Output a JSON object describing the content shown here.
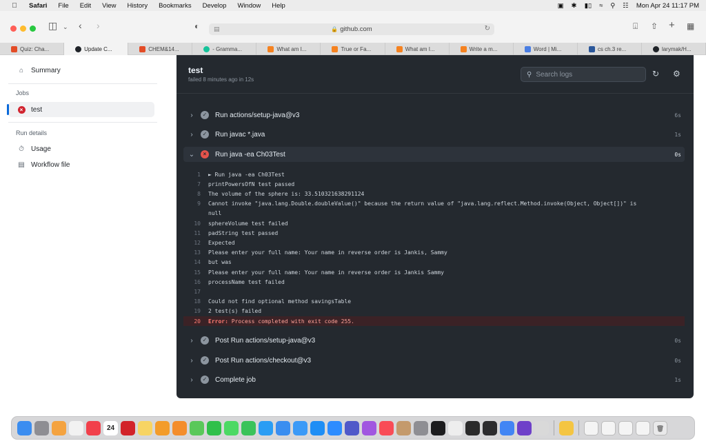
{
  "menubar": {
    "apple_icon": "apple-logo-icon",
    "items": [
      "Safari",
      "File",
      "Edit",
      "View",
      "History",
      "Bookmarks",
      "Develop",
      "Window",
      "Help"
    ],
    "datetime": "Mon Apr 24  11:17 PM"
  },
  "browser": {
    "url": "github.com",
    "tabs": [
      {
        "label": "Quiz: Cha...",
        "favicon_color": "#e34c26"
      },
      {
        "label": "Update C...",
        "favicon_color": "#1f2328"
      },
      {
        "label": "CHEM&14...",
        "favicon_color": "#e34c26"
      },
      {
        "label": "- Gramma...",
        "favicon_color": "#15c39a"
      },
      {
        "label": "What am I...",
        "favicon_color": "#f58220"
      },
      {
        "label": "True or Fa...",
        "favicon_color": "#f58220"
      },
      {
        "label": "What am I...",
        "favicon_color": "#f58220"
      },
      {
        "label": "Write a m...",
        "favicon_color": "#f58220"
      },
      {
        "label": "Word | Mi...",
        "favicon_color": "#4a7ee3"
      },
      {
        "label": "cs ch.3 re...",
        "favicon_color": "#2b579a"
      },
      {
        "label": "larymak/H...",
        "favicon_color": "#1f2328"
      }
    ],
    "active_tab": 1
  },
  "sidebar": {
    "summary_label": "Summary",
    "jobs_heading": "Jobs",
    "job_label": "test",
    "run_details_heading": "Run details",
    "usage_label": "Usage",
    "workflow_label": "Workflow file"
  },
  "job": {
    "title": "test",
    "subtitle": "failed 8 minutes ago in 12s",
    "search_placeholder": "Search logs"
  },
  "steps_before": [
    {
      "name": "Run actions/setup-java@v3",
      "duration": "6s",
      "status": "success"
    },
    {
      "name": "Run javac *.java",
      "duration": "1s",
      "status": "success"
    }
  ],
  "expanded_step": {
    "name": "Run java -ea Ch03Test",
    "duration": "0s",
    "status": "failure"
  },
  "log_lines": [
    {
      "num": "1",
      "text": "► Run java -ea Ch03Test"
    },
    {
      "num": "7",
      "text": "printPowersOfN test passed"
    },
    {
      "num": "8",
      "text": "The volume of the sphere is: 33.510321638291124"
    },
    {
      "num": "9",
      "text": "Cannot invoke \"java.lang.Double.doubleValue()\" because the return value of \"java.lang.reflect.Method.invoke(Object, Object[])\" is"
    },
    {
      "num": "",
      "text": "null"
    },
    {
      "num": "10",
      "text": "sphereVolume test failed"
    },
    {
      "num": "11",
      "text": "padString test passed"
    },
    {
      "num": "12",
      "text": "Expected"
    },
    {
      "num": "13",
      "text": "Please enter your full name: Your name in reverse order is Jankis, Sammy"
    },
    {
      "num": "14",
      "text": "but was"
    },
    {
      "num": "15",
      "text": "Please enter your full name: Your name in reverse order is Jankis Sammy"
    },
    {
      "num": "16",
      "text": "processName test failed"
    },
    {
      "num": "17",
      "text": ""
    },
    {
      "num": "18",
      "text": "Could not find optional method savingsTable"
    },
    {
      "num": "19",
      "text": "2 test(s) failed"
    }
  ],
  "error_line": {
    "num": "20",
    "keyword": "Error:",
    "text": " Process completed with exit code 255."
  },
  "steps_after": [
    {
      "name": "Post Run actions/setup-java@v3",
      "duration": "0s",
      "status": "success"
    },
    {
      "name": "Post Run actions/checkout@v3",
      "duration": "0s",
      "status": "success"
    },
    {
      "name": "Complete job",
      "duration": "1s",
      "status": "success"
    }
  ],
  "colors": {
    "failure": "#e5534b",
    "success": "#8c959f",
    "panel_bg": "#24292f",
    "accent": "#0969da"
  },
  "dock": {
    "calendar_day": "24",
    "apps": [
      {
        "name": "finder",
        "color": "#3b8df0"
      },
      {
        "name": "launchpad",
        "color": "#8e8e93"
      },
      {
        "name": "photos",
        "color": "#f4a340"
      },
      {
        "name": "reminders",
        "color": "#f2f2f2"
      },
      {
        "name": "news",
        "color": "#f1404b"
      },
      {
        "name": "calendar",
        "color": "#ffffff"
      },
      {
        "name": "acrobat",
        "color": "#d2232a"
      },
      {
        "name": "notes",
        "color": "#f7d463"
      },
      {
        "name": "pages",
        "color": "#f39c2a"
      },
      {
        "name": "books",
        "color": "#f48d2c"
      },
      {
        "name": "maps",
        "color": "#5ac85a"
      },
      {
        "name": "numbers",
        "color": "#30c04a"
      },
      {
        "name": "messages",
        "color": "#4cd964"
      },
      {
        "name": "facetime",
        "color": "#3ac35a"
      },
      {
        "name": "safari",
        "color": "#2a9df4"
      },
      {
        "name": "keynote",
        "color": "#3a8ef0"
      },
      {
        "name": "mail",
        "color": "#3b9af7"
      },
      {
        "name": "app-store",
        "color": "#1e8ef5"
      },
      {
        "name": "zoom",
        "color": "#2d8cff"
      },
      {
        "name": "teams",
        "color": "#5059c9"
      },
      {
        "name": "podcasts",
        "color": "#a156e0"
      },
      {
        "name": "music",
        "color": "#f94c57"
      },
      {
        "name": "contacts",
        "color": "#c49a6c"
      },
      {
        "name": "settings",
        "color": "#8e8e93"
      },
      {
        "name": "apple-tv",
        "color": "#1c1c1e"
      },
      {
        "name": "textedit",
        "color": "#eeeeee"
      },
      {
        "name": "terminal",
        "color": "#2b2b2b"
      },
      {
        "name": "activity-monitor",
        "color": "#2c2c2e"
      },
      {
        "name": "chrome",
        "color": "#4285f4"
      },
      {
        "name": "github-desktop",
        "color": "#6e40c9"
      },
      {
        "name": "preview",
        "color": "#d9d9d9"
      },
      {
        "name": "cyberduck",
        "color": "#f4c542"
      }
    ],
    "trash_icon": "trash-icon"
  }
}
